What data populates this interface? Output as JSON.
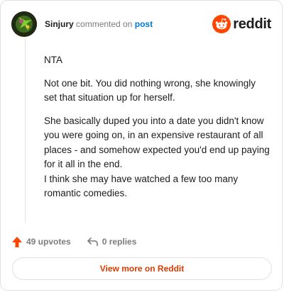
{
  "header": {
    "username": "Sinjury",
    "commented_on": "commented on",
    "post_link": "post",
    "brand": "reddit",
    "avatar_icon": "user-avatar-icon",
    "brand_icon": "reddit-logo-icon"
  },
  "comment": {
    "paragraphs": [
      "NTA",
      "Not one bit. You did nothing wrong, she knowingly set that situation up for herself.",
      "She basically duped you into a date you didn't know you were going on, in an expensive restaurant of all places - and somehow expected you'd end up paying for it all in the end.",
      "I think she may have watched a few too many romantic comedies."
    ]
  },
  "actions": {
    "upvotes": "49 upvotes",
    "replies": "0 replies",
    "upvote_icon": "upvote-arrow-icon",
    "reply_icon": "reply-arrow-icon"
  },
  "footer": {
    "view_more": "View more on Reddit"
  },
  "colors": {
    "accent": "#d93a00",
    "upvote": "#ff4500",
    "link": "#0079d3",
    "text": "#1c1c1c",
    "muted": "#7c7c7c",
    "border": "#dfe3e6"
  }
}
